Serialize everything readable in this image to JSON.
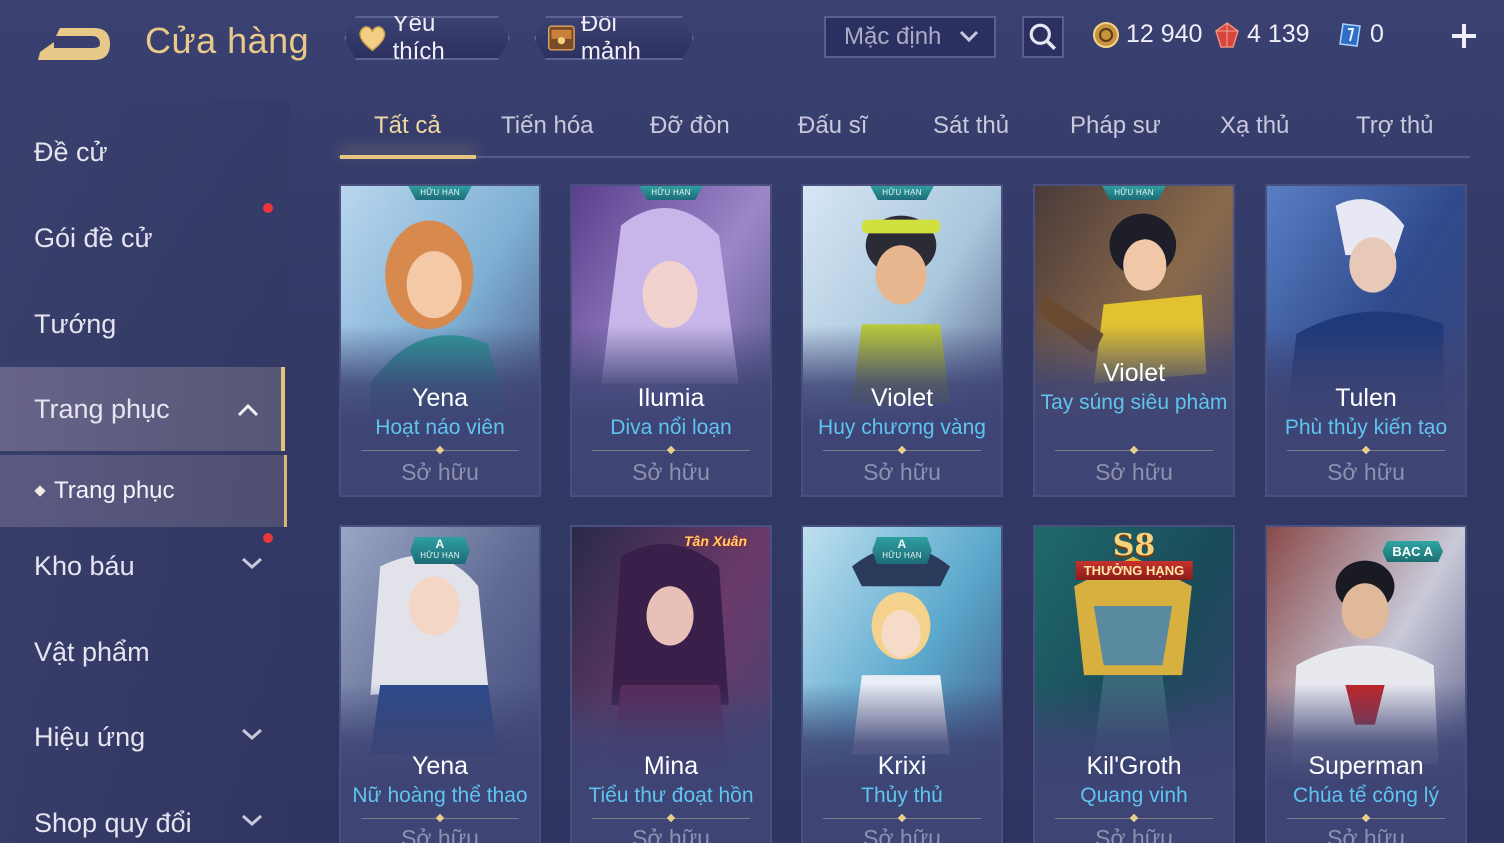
{
  "header": {
    "title": "Cửa hàng",
    "favorite_label": "Yêu thích",
    "exchange_label": "Đổi mảnh",
    "sort_value": "Mặc định",
    "currencies": {
      "gold": "12 940",
      "gems": "4 139",
      "vouchers": "0"
    }
  },
  "sidebar": {
    "items": [
      {
        "label": "Đề cử"
      },
      {
        "label": "Gói đề cử"
      },
      {
        "label": "Tướng"
      },
      {
        "label": "Trang phục"
      },
      {
        "label": "Trang phục"
      },
      {
        "label": "Kho báu"
      },
      {
        "label": "Vật phẩm"
      },
      {
        "label": "Hiệu ứng"
      },
      {
        "label": "Shop quy đổi"
      }
    ]
  },
  "tabs": [
    {
      "label": "Tất cả"
    },
    {
      "label": "Tiến hóa"
    },
    {
      "label": "Đỡ đòn"
    },
    {
      "label": "Đấu sĩ"
    },
    {
      "label": "Sát thủ"
    },
    {
      "label": "Pháp sư"
    },
    {
      "label": "Xạ thủ"
    },
    {
      "label": "Trợ thủ"
    }
  ],
  "cards": [
    {
      "hero": "Yena",
      "skin": "Hoạt náo viên",
      "status": "Sở hữu",
      "badge": "HỮU HẠN"
    },
    {
      "hero": "Ilumia",
      "skin": "Diva nổi loạn",
      "status": "Sở hữu",
      "badge": "HỮU HẠN"
    },
    {
      "hero": "Violet",
      "skin": "Huy chương vàng",
      "status": "Sở hữu",
      "badge": "HỮU HẠN"
    },
    {
      "hero": "Violet",
      "skin": "Tay súng siêu phàm",
      "status": "Sở hữu",
      "badge": "HỮU HẠN"
    },
    {
      "hero": "Tulen",
      "skin": "Phù thủy kiến tạo",
      "status": "Sở hữu"
    },
    {
      "hero": "Yena",
      "skin": "Nữ hoàng thể thao",
      "status": "Sở hữu",
      "badge": "HỮU HẠN",
      "grade": "A"
    },
    {
      "hero": "Mina",
      "skin": "Tiểu thư đoạt hồn",
      "status": "Sở hữu",
      "event": "Tân Xuân"
    },
    {
      "hero": "Krixi",
      "skin": "Thủy thủ",
      "status": "Sở hữu",
      "badge": "HỮU HẠN",
      "grade": "A"
    },
    {
      "hero": "Kil'Groth",
      "skin": "Quang vinh",
      "status": "Sở hữu",
      "season": "S8",
      "rank": "THƯỞNG HẠNG"
    },
    {
      "hero": "Superman",
      "skin": "Chúa tể công lý",
      "status": "Sở hữu",
      "tier": "BẠC A"
    }
  ],
  "colors": {
    "accent_gold": "#e6c782",
    "skin_name": "#5fc4f0",
    "notification": "#e8363a"
  }
}
